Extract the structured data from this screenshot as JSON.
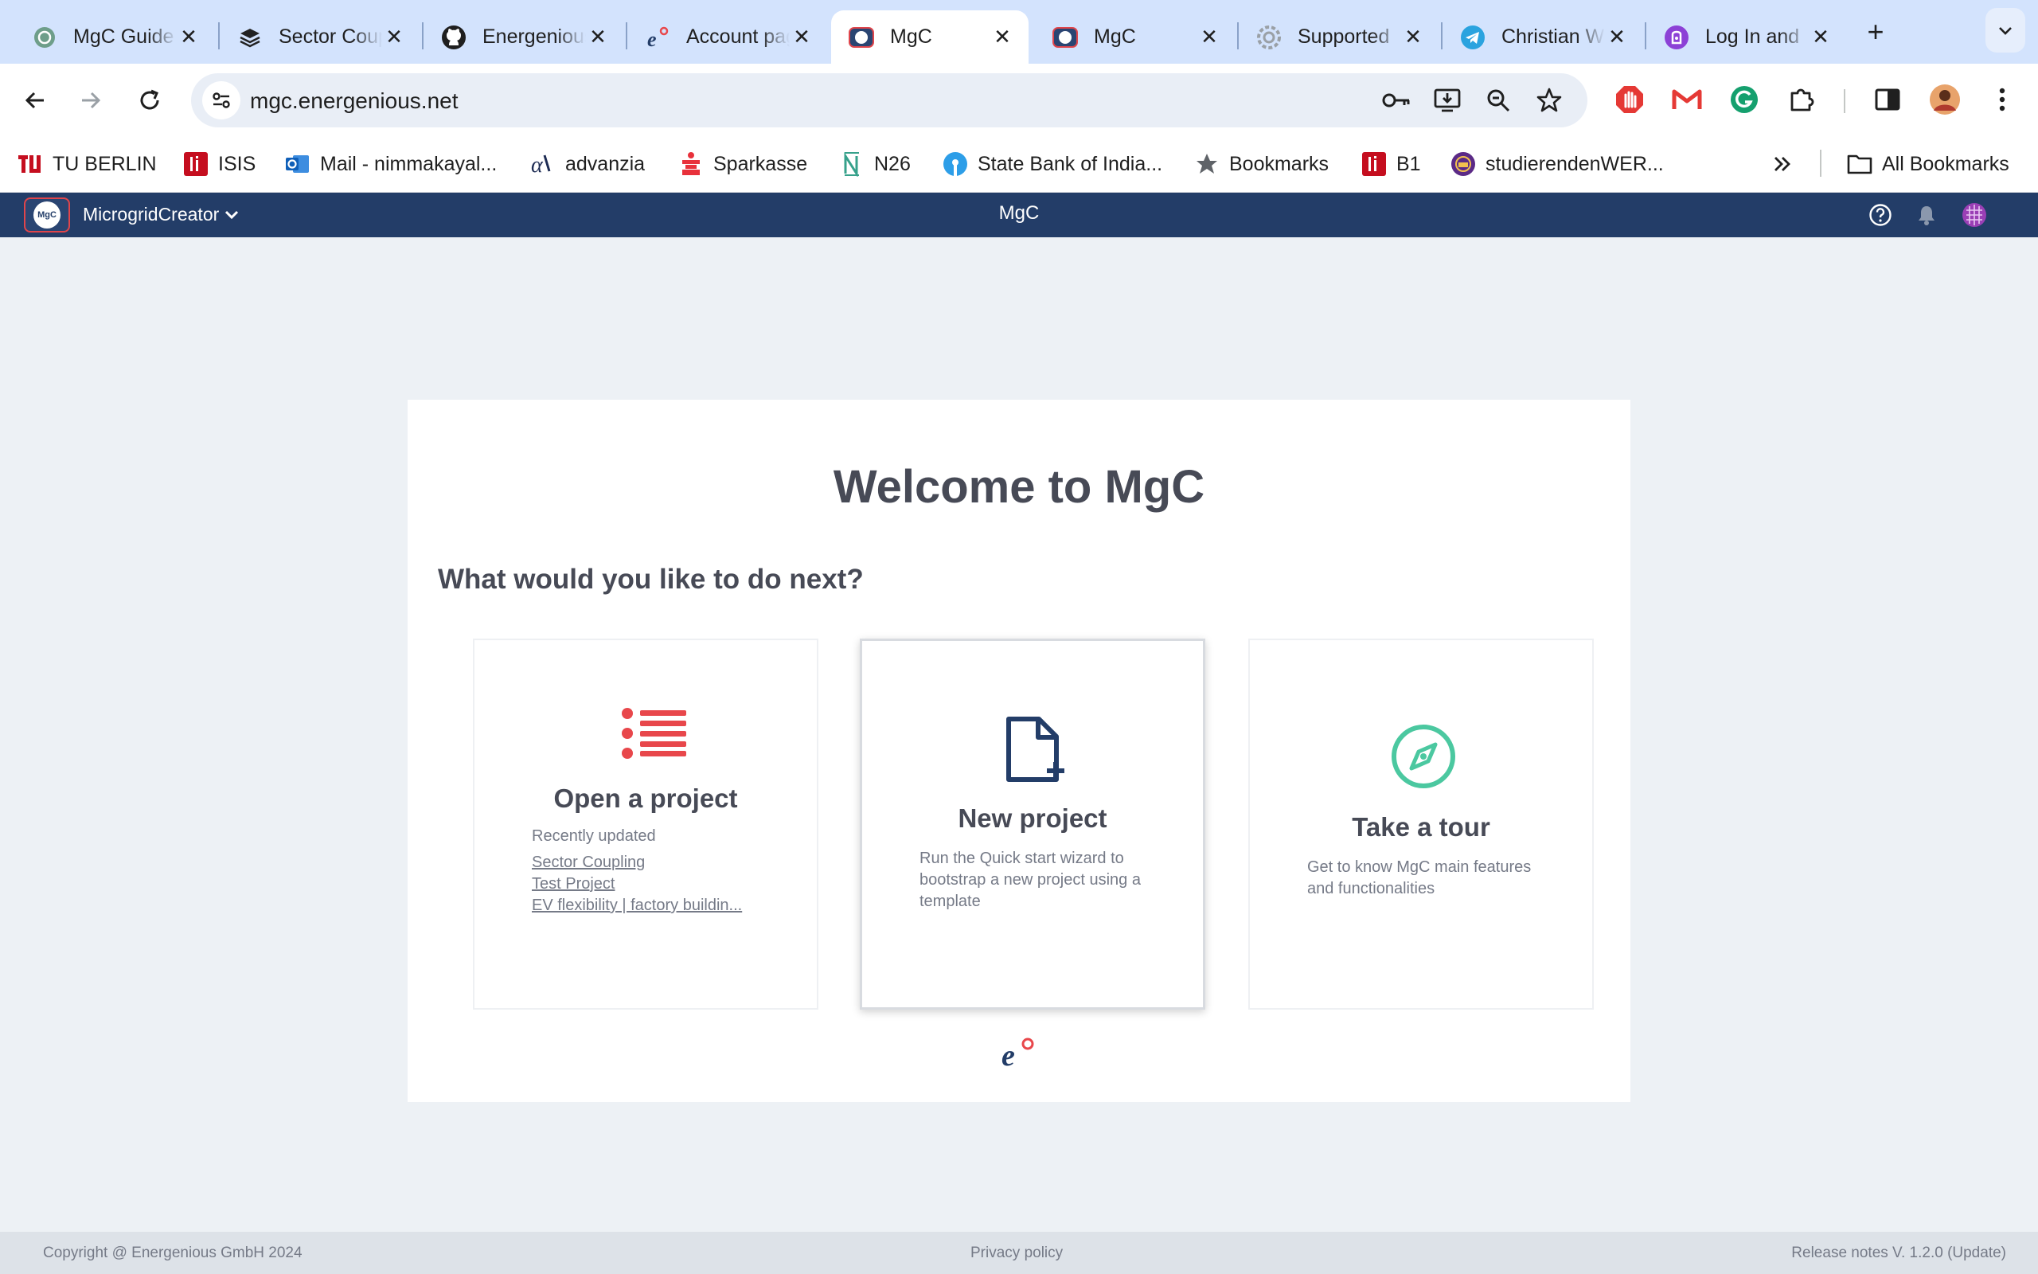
{
  "browser": {
    "tabs": [
      {
        "title": "MgC Guide",
        "icon": "openai-icon",
        "active": false
      },
      {
        "title": "Sector Coupling",
        "icon": "layers-icon",
        "active": false
      },
      {
        "title": "Energenious",
        "icon": "github-icon",
        "active": false
      },
      {
        "title": "Account page",
        "icon": "energenious-icon",
        "active": false
      },
      {
        "title": "MgC",
        "icon": "mgc-icon",
        "active": true
      },
      {
        "title": "MgC",
        "icon": "mgc-icon",
        "active": false
      },
      {
        "title": "Supported",
        "icon": "gear-icon",
        "active": false
      },
      {
        "title": "Christian W",
        "icon": "telegram-icon",
        "active": false
      },
      {
        "title": "Log In and",
        "icon": "proton-icon",
        "active": false
      }
    ],
    "url": "mgc.energenious.net",
    "bookmarks": [
      {
        "label": "TU BERLIN",
        "icon": "tu-icon"
      },
      {
        "label": "ISIS",
        "icon": "isis-icon"
      },
      {
        "label": "Mail - nimmakayal...",
        "icon": "outlook-icon"
      },
      {
        "label": "advanzia",
        "icon": "advanzia-icon"
      },
      {
        "label": "Sparkasse",
        "icon": "sparkasse-icon"
      },
      {
        "label": "N26",
        "icon": "n26-icon"
      },
      {
        "label": "State Bank of India...",
        "icon": "sbi-icon"
      },
      {
        "label": "Bookmarks",
        "icon": "star-icon"
      },
      {
        "label": "B1",
        "icon": "isis-icon"
      },
      {
        "label": "studierendenWER...",
        "icon": "studierendenwerk-icon"
      }
    ],
    "all_bookmarks": "All Bookmarks"
  },
  "app": {
    "switcher": "MicrogridCreator",
    "title": "MgC",
    "logo_text": "MgC"
  },
  "welcome": {
    "heading": "Welcome to MgC",
    "subheading": "What would you like to do next?",
    "open_project": {
      "title": "Open a project",
      "recent_label": "Recently updated",
      "recent": [
        "Sector Coupling",
        "Test Project",
        "EV flexibility | factory buildin..."
      ]
    },
    "new_project": {
      "title": "New project",
      "description": "Run the Quick start wizard to bootstrap a new project using a template"
    },
    "tour": {
      "title": "Take a tour",
      "description": "Get to know MgC main features and functionalities"
    }
  },
  "footer": {
    "copyright": "Copyright @ Energenious GmbH 2024",
    "privacy": "Privacy policy",
    "release": "Release notes V. 1.2.0 (Update)"
  },
  "colors": {
    "appbar": "#233d68",
    "accent_red": "#e8474b",
    "accent_blue": "#233d68",
    "accent_green": "#4bc8a0"
  }
}
